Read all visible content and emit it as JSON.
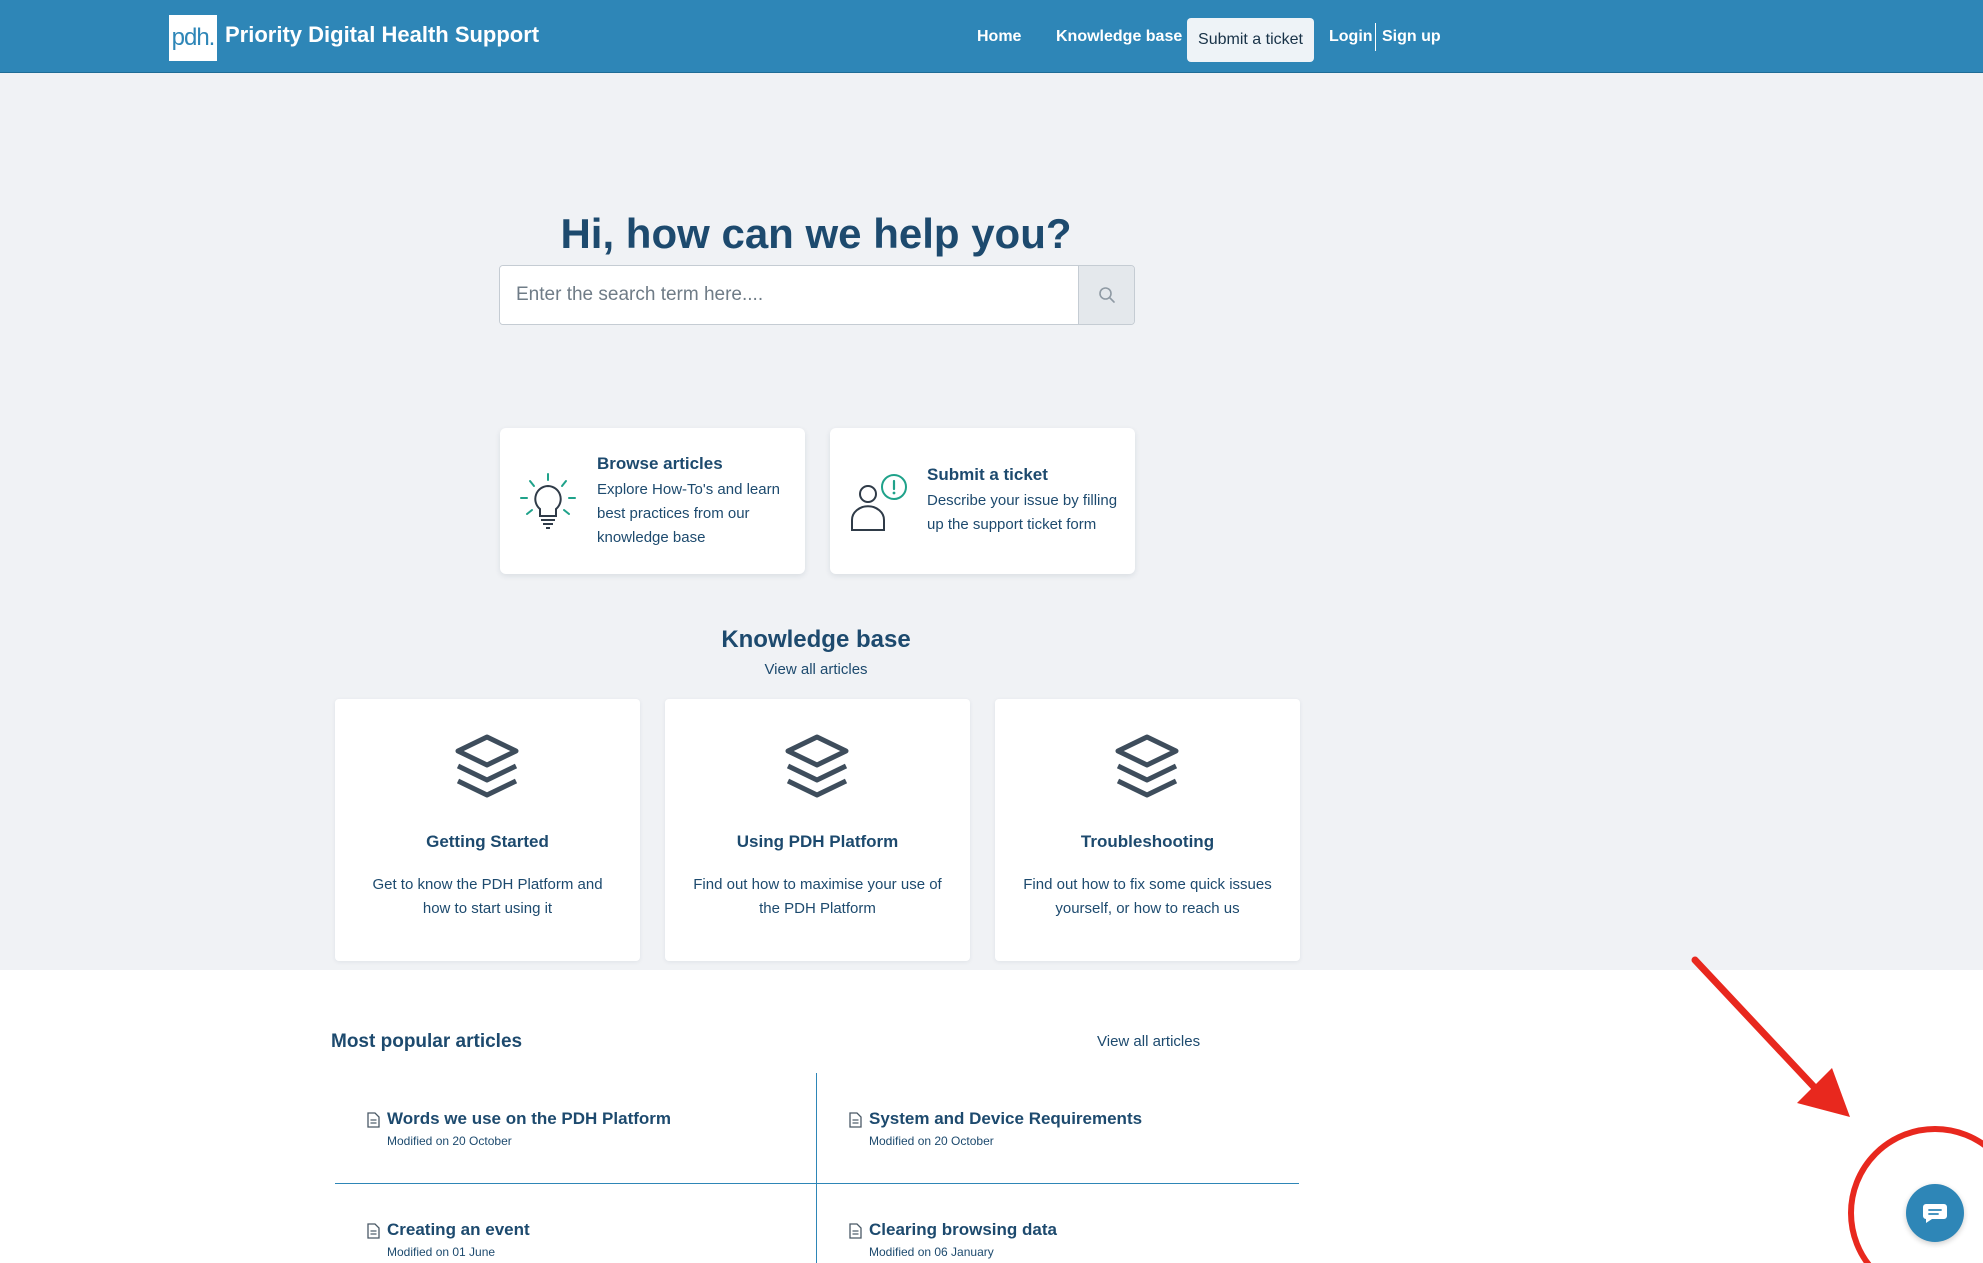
{
  "header": {
    "logo_text": "pdh.",
    "brand": "Priority Digital Health Support",
    "nav": {
      "home": "Home",
      "knowledge_base": "Knowledge base",
      "submit_ticket": "Submit a ticket",
      "login": "Login",
      "signup": "Sign up"
    },
    "colors": {
      "bar": "#2e86b7"
    }
  },
  "hero": {
    "title": "Hi, how can we help you?",
    "search": {
      "placeholder": "Enter the search term here....",
      "value": ""
    }
  },
  "actions": [
    {
      "title": "Browse articles",
      "description": "Explore How-To's and learn best practices from our knowledge base",
      "icon": "lightbulb-icon"
    },
    {
      "title": "Submit a ticket",
      "description": "Describe your issue by filling up the support ticket form",
      "icon": "person-alert-icon"
    }
  ],
  "knowledge_base": {
    "title": "Knowledge base",
    "view_all": "View all articles",
    "categories": [
      {
        "title": "Getting Started",
        "description": "Get to know the PDH Platform and how to start using it",
        "icon": "layers-icon"
      },
      {
        "title": "Using PDH Platform",
        "description": "Find out how to maximise your use of the PDH Platform",
        "icon": "layers-icon"
      },
      {
        "title": "Troubleshooting",
        "description": "Find out how to fix some quick issues yourself, or how to reach us",
        "icon": "layers-icon"
      }
    ]
  },
  "popular": {
    "title": "Most popular articles",
    "view_all": "View all articles",
    "articles": [
      {
        "title": "Words we use on the PDH Platform",
        "modified": "Modified on 20 October"
      },
      {
        "title": "System and Device Requirements",
        "modified": "Modified on 20 October"
      },
      {
        "title": "Creating an event",
        "modified": "Modified on 01 June"
      },
      {
        "title": "Clearing browsing data",
        "modified": "Modified on 06 January"
      }
    ]
  },
  "chat": {
    "icon": "chat-bubble-icon"
  },
  "annotation": {
    "color": "#e8281e"
  }
}
